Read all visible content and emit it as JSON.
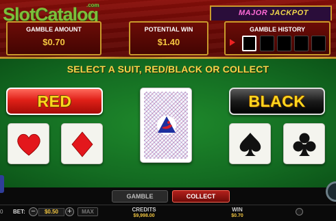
{
  "watermark": {
    "brand": "SlotCatalog",
    "suffix": ".com"
  },
  "jackpot": {
    "major": "MAJOR",
    "jackpot": "JACKPOT"
  },
  "gamble_amount": {
    "label": "GAMBLE AMOUNT",
    "value": "$0.70"
  },
  "potential_win": {
    "label": "POTENTIAL WIN",
    "value": "$1.40"
  },
  "gamble_history": {
    "label": "GAMBLE HISTORY",
    "slots": 5
  },
  "instruction": "SELECT A SUIT, RED/BLACK OR COLLECT",
  "buttons": {
    "red": "RED",
    "black": "BLACK"
  },
  "suits": [
    "heart-icon",
    "diamond-icon",
    "spade-icon",
    "club-icon"
  ],
  "colors": {
    "felt": "#146d22",
    "gold": "#f3c640",
    "red": "#e02018",
    "accent_yellow": "#ffd61e"
  },
  "tabs": {
    "gamble": "GAMBLE",
    "collect": "COLLECT",
    "active": "collect"
  },
  "footer": {
    "left_value": "0",
    "bet_label": "BET:",
    "bet_value": "$0.50",
    "bet_minus": "−",
    "bet_plus": "+",
    "max": "MAX",
    "credits_label": "CREDITS",
    "credits_value": "$9,998.00",
    "win_label": "WIN",
    "win_value": "$0.70"
  }
}
